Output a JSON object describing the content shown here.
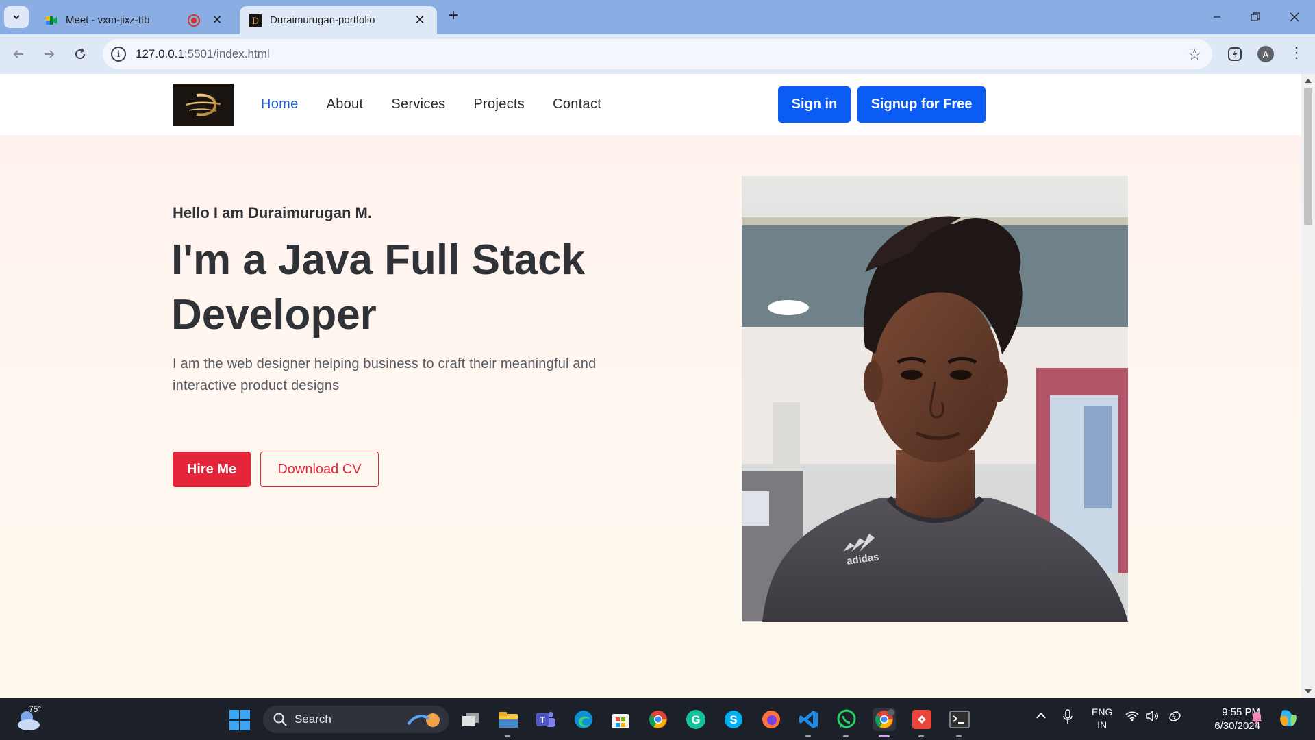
{
  "browser": {
    "tabs": [
      {
        "title": "Meet - vxm-jixz-ttb",
        "active": false
      },
      {
        "title": "Duraimurugan-portfolio",
        "active": true
      }
    ],
    "url_host": "127.0.0.1",
    "url_rest": ":5501/index.html",
    "profile_initial": "A",
    "accent_color": "#8aaee3"
  },
  "site": {
    "nav": [
      {
        "label": "Home",
        "active": true
      },
      {
        "label": "About"
      },
      {
        "label": "Services"
      },
      {
        "label": "Projects"
      },
      {
        "label": "Contact"
      }
    ],
    "signin_label": "Sign in",
    "signup_label": "Signup for Free",
    "brand_color": "#0b5cf5"
  },
  "hero": {
    "greeting": "Hello I am Duraimurugan M.",
    "headline": "I'm a Java Full Stack Developer",
    "intro": "I am the web designer helping business to craft their meaningful and interactive product designs",
    "hire_label": "Hire Me",
    "cv_label": "Download CV",
    "accent_color": "#e5263a",
    "shirt_logo_text": "adidas"
  },
  "taskbar": {
    "weather_temp": "75°",
    "search_label": "Search",
    "lang_top": "ENG",
    "lang_bottom": "IN",
    "time": "9:55 PM",
    "date": "6/30/2024"
  }
}
